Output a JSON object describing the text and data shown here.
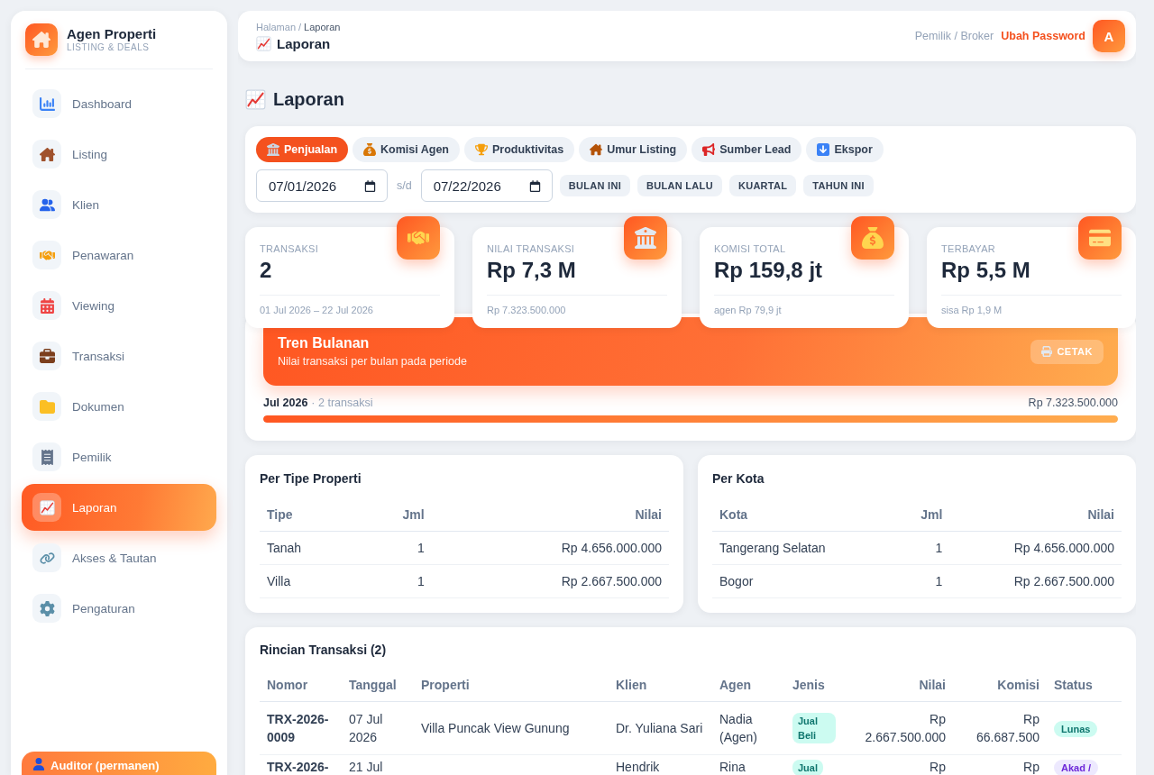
{
  "sidebar": {
    "brand": {
      "title": "Agen Properti",
      "subtitle": "LISTING & DEALS"
    },
    "items": [
      {
        "label": "Dashboard",
        "selected": false
      },
      {
        "label": "Listing",
        "selected": false
      },
      {
        "label": "Klien",
        "selected": false
      },
      {
        "label": "Penawaran",
        "selected": false
      },
      {
        "label": "Viewing",
        "selected": false
      },
      {
        "label": "Transaksi",
        "selected": false
      },
      {
        "label": "Dokumen",
        "selected": false
      },
      {
        "label": "Pemilik",
        "selected": false
      },
      {
        "label": "Laporan",
        "selected": true
      },
      {
        "label": "Akses & Tautan",
        "selected": false
      },
      {
        "label": "Pengaturan",
        "selected": false
      }
    ],
    "footer": {
      "label": "Auditor (permanen)"
    }
  },
  "header": {
    "breadcrumb": {
      "items": [
        "Halaman",
        "Laporan"
      ],
      "separator": "/"
    },
    "title": "Laporan",
    "role": "Pemilik / Broker",
    "password_link": "Ubah Password",
    "avatar": "A"
  },
  "page_title": "Laporan",
  "filters": {
    "tabs": [
      {
        "label": "Penjualan",
        "selected": true
      },
      {
        "label": "Komisi Agen",
        "selected": false
      },
      {
        "label": "Produktivitas",
        "selected": false
      },
      {
        "label": "Umur Listing",
        "selected": false
      },
      {
        "label": "Sumber Lead",
        "selected": false
      },
      {
        "label": "Ekspor",
        "selected": false
      }
    ],
    "date_from": "07/01/2026",
    "range_separator": "s/d",
    "date_to": "07/22/2026",
    "quick_ranges": [
      "BULAN INI",
      "BULAN LALU",
      "KUARTAL",
      "TAHUN INI"
    ]
  },
  "stats": [
    {
      "label": "TRANSAKSI",
      "value": "2",
      "note": "01 Jul 2026 – 22 Jul 2026"
    },
    {
      "label": "NILAI TRANSAKSI",
      "value": "Rp 7,3 M",
      "note": "Rp 7.323.500.000"
    },
    {
      "label": "KOMISI TOTAL",
      "value": "Rp 159,8 jt",
      "note": "agen Rp 79,9 jt"
    },
    {
      "label": "TERBAYAR",
      "value": "Rp 5,5 M",
      "note": "sisa Rp 1,9 M"
    }
  ],
  "trend": {
    "title": "Tren Bulanan",
    "subtitle": "Nilai transaksi per bulan pada periode",
    "print_button": "CETAK",
    "months": [
      {
        "month": "Jul 2026",
        "count": "· 2 transaksi",
        "value": "Rp 7.323.500.000",
        "level": 1
      }
    ]
  },
  "by_type": {
    "title": "Per Tipe Properti",
    "columns": [
      "Tipe",
      "Jml",
      "Nilai"
    ],
    "rows": [
      [
        "Tanah",
        "1",
        "Rp 4.656.000.000"
      ],
      [
        "Villa",
        "1",
        "Rp 2.667.500.000"
      ]
    ]
  },
  "by_city": {
    "title": "Per Kota",
    "columns": [
      "Kota",
      "Jml",
      "Nilai"
    ],
    "rows": [
      [
        "Tangerang Selatan",
        "1",
        "Rp 4.656.000.000"
      ],
      [
        "Bogor",
        "1",
        "Rp 2.667.500.000"
      ]
    ]
  },
  "transactions": {
    "title": "Rincian Transaksi (2)",
    "columns": [
      "Nomor",
      "Tanggal",
      "Properti",
      "Klien",
      "Agen",
      "Jenis",
      "Nilai",
      "Komisi",
      "Status"
    ],
    "rows": [
      {
        "number": "TRX-2026-0009",
        "date": "07 Jul 2026",
        "property": "Villa Puncak View Gunung",
        "client": "Dr. Yuliana Sari",
        "agent": "Nadia (Agen)",
        "type": "Jual Beli",
        "value": "Rp 2.667.500.000",
        "commission": "Rp 66.687.500",
        "status": {
          "label": "Lunas",
          "kind": "paid"
        }
      },
      {
        "number": "TRX-2026-",
        "date": "21 Jul",
        "client": "Hendrik",
        "agent": "Rina",
        "type": "Jual",
        "value": "Rp",
        "commission": "Rp",
        "status": {
          "label": "Akad /",
          "kind": "akad"
        }
      }
    ]
  }
}
